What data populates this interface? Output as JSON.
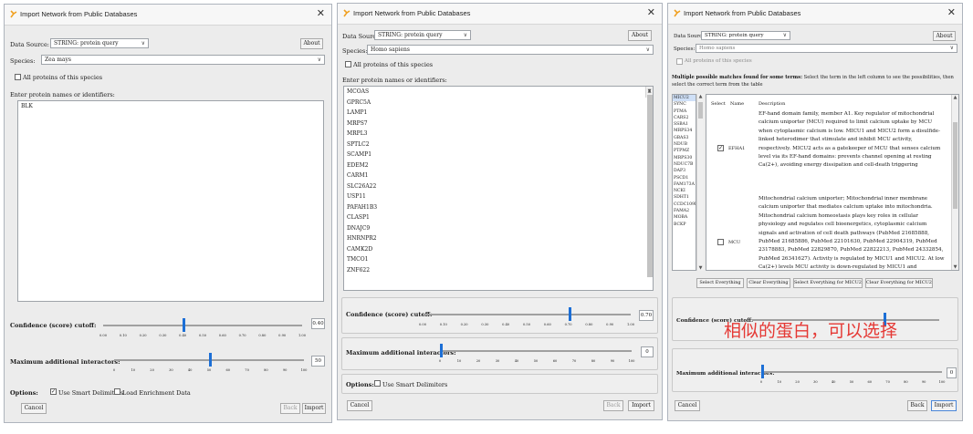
{
  "colors": {
    "accent": "#1c6fd6",
    "annotation": "#e53935"
  },
  "panels": [
    {
      "title": "Import Network from Public Databases",
      "data_source_label": "Data Source:",
      "data_source_value": "STRING: protein query",
      "about": "About",
      "species_label": "Species:",
      "species_value": "Zea mays",
      "all_proteins": "All proteins of this species",
      "enter_label": "Enter protein names or identifiers:",
      "proteins": [
        "BLK"
      ],
      "confidence_label": "Confidence (score) cutoff:",
      "confidence_ticks": [
        "0.00",
        "0.10",
        "0.20",
        "0.30",
        "0.40",
        "0.50",
        "0.60",
        "0.70",
        "0.80",
        "0.90",
        "1.00"
      ],
      "confidence_value": "0.40",
      "interactors_label": "Maximum additional interactors:",
      "interactors_ticks": [
        "0",
        "10",
        "20",
        "30",
        "40",
        "50",
        "60",
        "70",
        "80",
        "90",
        "100"
      ],
      "interactors_value": "50",
      "options_label": "Options:",
      "smart": "Use Smart Delimiters",
      "enrich": "Load Enrichment Data",
      "cancel": "Cancel",
      "back": "Back",
      "import": "Import"
    },
    {
      "title": "Import Network from Public Databases",
      "data_source_label": "Data Source:",
      "data_source_value": "STRING: protein query",
      "about": "About",
      "species_label": "Species:",
      "species_value": "Homo sapiens",
      "all_proteins": "All proteins of this species",
      "enter_label": "Enter protein names or identifiers:",
      "proteins": [
        "MCOAS",
        "GPRC5A",
        "LAMP1",
        "MRPS7",
        "MRPL3",
        "SPTLC2",
        "SCAMP1",
        "EDEM2",
        "CARM1",
        "SLC26A22",
        "USP11",
        "PAFAH1B3",
        "CLASP1",
        "DNAJC9",
        "HNRNPR2",
        "CAMK2D",
        "TMCO1",
        "ZNF622"
      ],
      "confidence_label": "Confidence (score) cutoff:",
      "confidence_ticks": [
        "0.00",
        "0.10",
        "0.20",
        "0.30",
        "0.40",
        "0.50",
        "0.60",
        "0.70",
        "0.80",
        "0.90",
        "1.00"
      ],
      "confidence_value": "0.70",
      "interactors_label": "Maximum additional interactors:",
      "interactors_ticks": [
        "0",
        "10",
        "20",
        "30",
        "40",
        "50",
        "60",
        "70",
        "80",
        "90",
        "100"
      ],
      "interactors_value": "0",
      "options_label": "Options:",
      "smart": "Use Smart Delimiters",
      "cancel": "Cancel",
      "back": "Back",
      "import": "Import"
    },
    {
      "title": "Import Network from Public Databases",
      "data_source_label": "Data Source:",
      "data_source_value": "STRING: protein query",
      "about": "About",
      "species_label": "Species:",
      "species_value": "Homo sapiens",
      "all_proteins": "All proteins of this species",
      "matches_bold": "Multiple possible matches found for some terms:",
      "matches_text": "Select the term in the left column to see the possibilities, then select the correct term from the table",
      "terms": [
        "MICU2",
        "SYNC",
        "PTMA",
        "CARS2",
        "SSBA1",
        "MRPS34",
        "GBAS3",
        "NDUB",
        "PTPMZ",
        "MRPS30",
        "NDUC7B",
        "DAP3",
        "PSCD1",
        "FAM173A",
        "NCKI",
        "SDHT1",
        "CCDC109B",
        "FAMA2",
        "MOBA",
        "BCKP"
      ],
      "col_select": "Select",
      "col_name": "Name",
      "col_desc": "Description",
      "rows": [
        {
          "name": "EFHA1",
          "checked": true,
          "desc": "EF-hand domain family, member A1. Key regulator of mitochondrial calcium uniporter (MCU) required to limit calcium uptake by MCU when cytoplasmic calcium is low. MICU1 and MICU2 form a disulfide-linked heterodimer that stimulate and inhibit MCU activity, respectively. MICU2 acts as a gatekeeper of MCU that senses calcium level via its EF-hand domains: prevents channel opening at resting Ca(2+), avoiding energy dissipation and cell-death triggering"
        },
        {
          "name": "MCU",
          "checked": false,
          "desc": "Mitochondrial calcium uniporter; Mitochondrial inner membrane calcium uniporter that mediates calcium uptake into mitochondria. Mitochondrial calcium homeostasis plays key roles in cellular physiology and regulates cell bioenergetics, cytoplasmic calcium signals and activation of cell death pathways (PubMed 21685888, PubMed 21685886, PubMed 22101630, PubMed 22904319, PubMed 23178883, PubMed 22829870, PubMed 22822213, PubMed 24332854, PubMed 26341627). Activity is regulated by MICU1 and MICU2. At low Ca(2+) levels MCU activity is down-regulated by MICU1 and"
        }
      ],
      "sel_everything": "Select Everything",
      "clear_everything": "Clear Everything",
      "sel_for": "Select Everything for MICU2",
      "clear_for": "Clear Everything for MICU2",
      "confidence_label": "Confidence (score) cutoff:",
      "interactors_label": "Maximum additional interactors:",
      "interactors_ticks": [
        "0",
        "10",
        "20",
        "30",
        "40",
        "50",
        "60",
        "70",
        "80",
        "90",
        "100"
      ],
      "interactors_value": "0",
      "cancel": "Cancel",
      "back": "Back",
      "import": "Import"
    }
  ],
  "annotation": "相似的蛋白，可以选择"
}
